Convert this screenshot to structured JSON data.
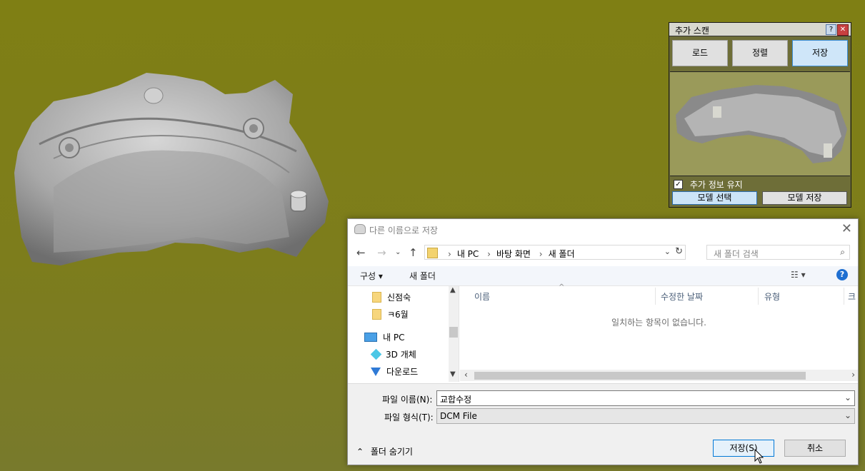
{
  "colors": {
    "background": "#7f7f14",
    "accent": "#0078d7",
    "selected_tool": "#cfe6f9"
  },
  "scan_panel": {
    "title": "추가 스캔",
    "tools": [
      "로드",
      "정렬",
      "저장"
    ],
    "selected_tool": "저장",
    "keep_info_label": "추가 정보 유지",
    "keep_info_checked": true,
    "model_select_label": "모델 선택",
    "model_save_label": "모델 저장"
  },
  "dialog": {
    "title": "다른 이름으로 저장",
    "breadcrumb": [
      "내 PC",
      "바탕 화면",
      "새 폴더"
    ],
    "search_placeholder": "새 폴더 검색",
    "toolbar": {
      "organize": "구성",
      "new_folder": "새 폴더"
    },
    "tree": [
      {
        "label": "신점숙",
        "icon": "folder-icon"
      },
      {
        "label": "ㅋ6월",
        "icon": "folder-icon"
      },
      {
        "label": "내 PC",
        "icon": "pc-icon"
      },
      {
        "label": "3D 개체",
        "icon": "3d-objects-icon"
      },
      {
        "label": "다운로드",
        "icon": "download-icon"
      }
    ],
    "columns": [
      "이름",
      "수정한 날짜",
      "유형",
      "크"
    ],
    "empty_message": "일치하는 항목이 없습니다.",
    "filename_label": "파일 이름(N):",
    "filename_value": "교합수정",
    "filetype_label": "파일 형식(T):",
    "filetype_value": "DCM File",
    "hide_folders_label": "폴더 숨기기",
    "save_label": "저장(S)",
    "cancel_label": "취소"
  }
}
